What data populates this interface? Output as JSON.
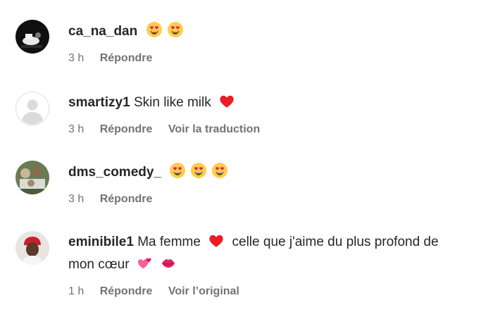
{
  "comments": [
    {
      "username": "ca_na_dan",
      "text": "",
      "time": "3 h",
      "reply_label": "Répondre",
      "extra_action": "",
      "avatar": "dark-photo-avatar"
    },
    {
      "username": "smartizy1",
      "text": "Skin like milk",
      "time": "3 h",
      "reply_label": "Répondre",
      "extra_action": "Voir la traduction",
      "avatar": "default-avatar"
    },
    {
      "username": "dms_comedy_",
      "text": "",
      "time": "3 h",
      "reply_label": "Répondre",
      "extra_action": "",
      "avatar": "group-photo-avatar"
    },
    {
      "username": "eminibile1",
      "text_part1": "Ma femme",
      "text_part2": "celle que j'aime du plus profond de",
      "text_part3": "mon cœur",
      "time": "1 h",
      "reply_label": "Répondre",
      "extra_action": "Voir l’original",
      "avatar": "red-cap-avatar"
    }
  ],
  "colors": {
    "text": "#262626",
    "secondary": "#737373",
    "heart": "#ed1c24",
    "emoji_face": "#ffcc4d"
  }
}
